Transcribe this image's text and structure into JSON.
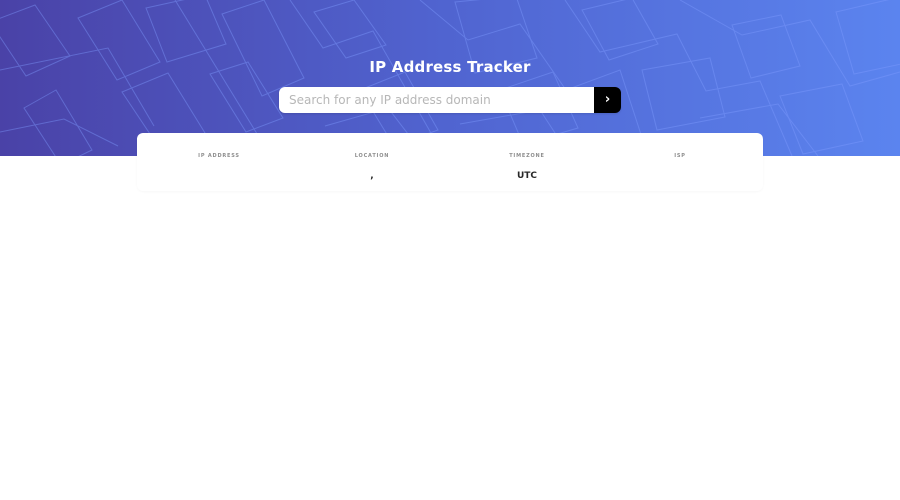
{
  "header": {
    "title": "IP Address Tracker"
  },
  "search": {
    "placeholder": "Search for any IP address domain",
    "value": "",
    "submit_label": "›"
  },
  "info": {
    "ip_address": {
      "label": "IP ADDRESS",
      "value": ""
    },
    "location": {
      "label": "LOCATION",
      "value": ","
    },
    "timezone": {
      "label": "TIMEZONE",
      "value": "UTC"
    },
    "isp": {
      "label": "ISP",
      "value": ""
    }
  },
  "colors": {
    "hero_gradient_start": "#4a42a7",
    "hero_gradient_end": "#5b84ef",
    "search_button": "#000000",
    "card_background": "#ffffff"
  },
  "icons": {
    "submit": "chevron-right-icon",
    "background": "map-pattern-icon"
  }
}
